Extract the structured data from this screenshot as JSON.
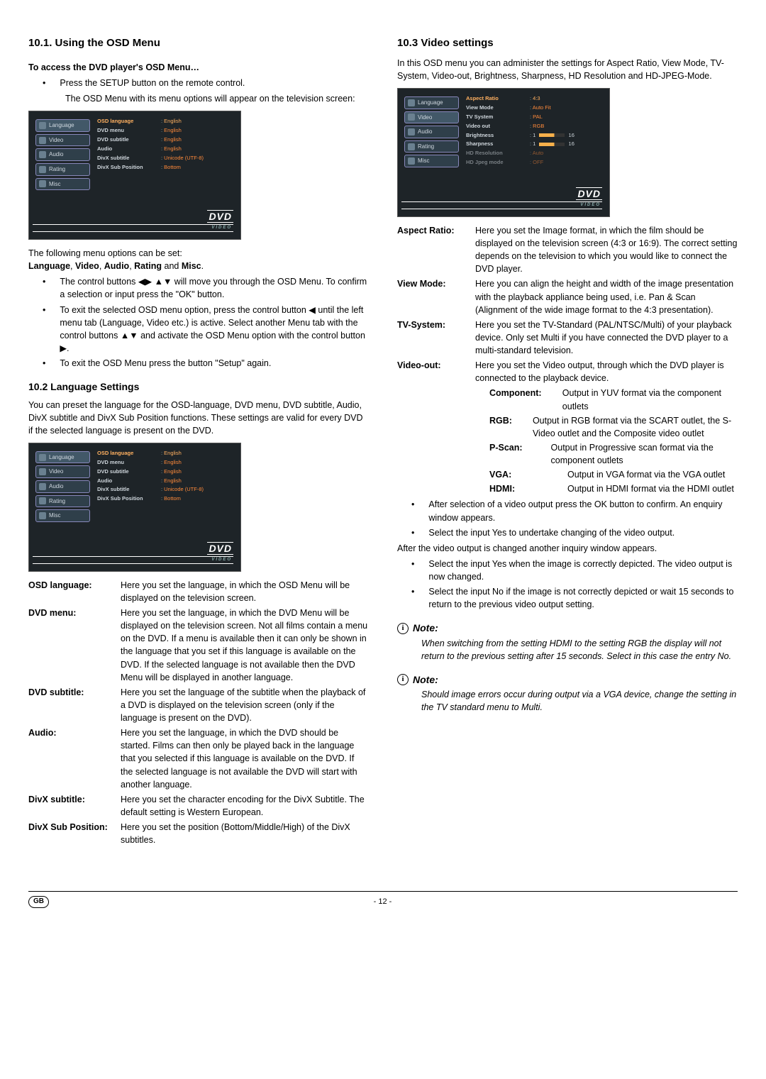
{
  "left": {
    "h_101": "10.1. Using the OSD Menu",
    "access_heading": "To access the DVD player's OSD Menu…",
    "press_setup": "Press the SETUP button on the remote control.",
    "press_setup_2": "The OSD Menu with its menu options will appear on the television screen:",
    "osd1": {
      "tabs": [
        "Language",
        "Video",
        "Audio",
        "Rating",
        "Misc"
      ],
      "rows": [
        {
          "k": "OSD language",
          "v": "English",
          "sel": true
        },
        {
          "k": "DVD menu",
          "v": "English"
        },
        {
          "k": "DVD subtitle",
          "v": "English"
        },
        {
          "k": "Audio",
          "v": "English"
        },
        {
          "k": "DivX subtitle",
          "v": "Unicode (UTF-8)"
        },
        {
          "k": "DivX Sub Position",
          "v": "Bottom"
        }
      ],
      "logo": "DVD",
      "logo_sub": "VIDEO"
    },
    "after_fig1_1": "The following menu options can be set:",
    "after_fig1_2": "Language, Video, Audio, Rating and Misc.",
    "bul_ctrl": "The control buttons ◀▶ ▲▼ will move you through the OSD Menu. To confirm a selection or input press the \"OK\" button.",
    "bul_exit1": "To exit the selected OSD menu option, press the control button ◀ until the left menu tab (Language, Video etc.) is active. Select another Menu tab with the control buttons ▲▼ and activate the OSD Menu option with the control button ▶.",
    "bul_exit2": "To exit the OSD Menu press the button \"Setup\" again.",
    "h_102": "10.2 Language Settings",
    "p_102": "You can preset the language for the OSD-language, DVD menu, DVD subtitle, Audio, DivX subtitle and DivX Sub Position functions. These settings are valid for every DVD if the selected language is present on the DVD.",
    "defs": [
      {
        "t": "OSD language:",
        "d": "Here you set the language, in which the OSD Menu will be displayed on the television screen."
      },
      {
        "t": "DVD menu:",
        "d": "Here you set the language, in which the DVD Menu will be displayed on the television screen. Not all films contain a menu on the DVD. If a menu is available then it can only be shown in the language that you set if this language is available on the DVD. If the selected language is not available then the DVD Menu will be displayed in another language."
      },
      {
        "t": "DVD subtitle:",
        "d": "Here you set the language of the subtitle when the playback of a DVD is displayed on the television screen (only if the language is present on the DVD)."
      },
      {
        "t": "Audio:",
        "d": "Here you set the language, in which the DVD should be started. Films can then only be played back in the language that you selected if this language is available on the DVD. If the selected language is not available the DVD will start with another language."
      },
      {
        "t": "DivX subtitle:",
        "d": "Here you set the character encoding for the DivX Subtitle. The default setting is Western European."
      },
      {
        "t": "DivX Sub Position:",
        "d": "Here you set the position (Bottom/Middle/High) of the DivX subtitles."
      }
    ]
  },
  "right": {
    "h_103": "10.3 Video settings",
    "intro": "In this OSD menu you can administer the settings for Aspect Ratio, View Mode, TV-System, Video-out, Brightness, Sharpness, HD Resolution and HD-JPEG-Mode.",
    "osd2": {
      "tabs": [
        "Language",
        "Video",
        "Audio",
        "Rating",
        "Misc"
      ],
      "rows": [
        {
          "k": "Aspect Ratio",
          "v": "4:3",
          "sel": true
        },
        {
          "k": "View Mode",
          "v": "Auto Fit"
        },
        {
          "k": "TV System",
          "v": "PAL"
        },
        {
          "k": "Video out",
          "v": "RGB"
        },
        {
          "k": "Brightness",
          "v": "1",
          "slider": true,
          "max": "16"
        },
        {
          "k": "Sharpness",
          "v": "1",
          "slider": true,
          "max": "16"
        },
        {
          "k": "HD Resolution",
          "v": "Auto",
          "dim": true
        },
        {
          "k": "HD Jpeg mode",
          "v": "OFF",
          "dim": true
        }
      ],
      "logo": "DVD",
      "logo_sub": "VIDEO"
    },
    "defs": [
      {
        "t": "Aspect Ratio:",
        "d": "Here you set the Image format, in which the film should be displayed on the television screen (4:3 or 16:9). The correct setting depends on the television to which you would like to connect the DVD player."
      },
      {
        "t": "View Mode:",
        "d": "Here you can align the height and width of the image presentation with the playback appliance being used, i.e. Pan & Scan (Alignment of the wide image format to the 4:3 presentation)."
      },
      {
        "t": "TV-System:",
        "d": "Here you set the TV-Standard (PAL/NTSC/Multi) of your playback device. Only set Multi if you have connected the DVD player to a multi-standard television."
      },
      {
        "t": "Video-out:",
        "d": "Here you set the Video output, through which the DVD player is connected to the playback device."
      }
    ],
    "sub": [
      {
        "t": "Component:",
        "d": "Output in YUV format via the component outlets"
      },
      {
        "t": "RGB:",
        "d": "Output in RGB format via the SCART outlet, the S-Video outlet and the Composite video outlet"
      },
      {
        "t": "P-Scan:",
        "d": "Output in Progressive scan format via the component outlets"
      },
      {
        "t": "VGA:",
        "d": "Output in VGA format via the VGA outlet"
      },
      {
        "t": "HDMI:",
        "d": "Output in HDMI format via the HDMI outlet"
      }
    ],
    "bul_after1": "After selection of a video output press the OK button to confirm. An enquiry window appears.",
    "bul_after2": "Select the input Yes to undertake changing of the video output.",
    "line_after": "After the video output is changed another inquiry window appears.",
    "bul_yes": "Select the input Yes when the image is correctly depicted. The video output is now changed.",
    "bul_no": "Select the input No if the image is not correctly depicted or wait 15 seconds to return to the previous video output setting.",
    "note1_h": "Note:",
    "note1_b": "When switching from the setting HDMI to the setting RGB the display will not return to the previous setting after 15 seconds. Select in this case the entry No.",
    "note2_h": "Note:",
    "note2_b": "Should image errors occur during output via a VGA device, change the setting in the TV standard menu to Multi."
  },
  "footer": {
    "gb": "GB",
    "page": "- 12 -"
  }
}
